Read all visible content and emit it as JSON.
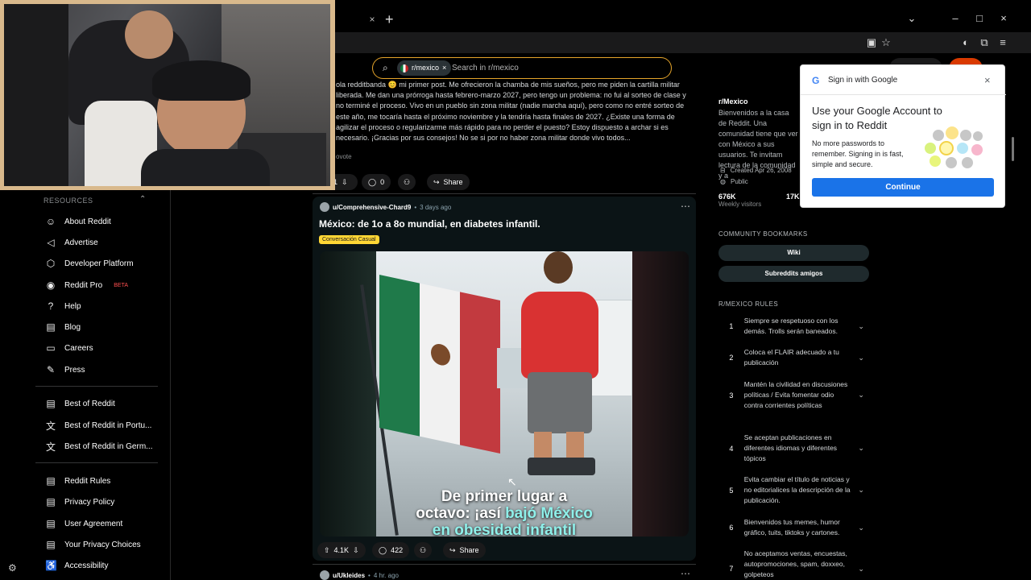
{
  "browser": {
    "new_tab": "+",
    "tab_close": "×",
    "minimize": "–",
    "maximize": "□",
    "close": "×",
    "chevron": "⌄"
  },
  "search": {
    "subreddit_chip": "r/mexico",
    "chip_close": "×",
    "placeholder": "Search in r/mexico"
  },
  "feed": {
    "prev_post_text": "ola redditbanda 😊 mi primer post. Me ofrecieron la chamba de mis sueños, pero me piden la cartilla militar liberada. Me dan una prórroga hasta febrero-marzo 2027, pero tengo un problema: no fui al sorteo de clase y no terminé el proceso. Vivo en un pueblo sin zona militar (nadie marcha aquí), pero como no entré sorteo de este año, me tocaría hasta el próximo noviembre y la tendría hasta finales de 2027. ¿Existe una forma de agilizar el proceso o regularizarme más rápido para no perder el puesto? Estoy dispuesto a archar si es necesario. ¡Gracias por sus consejos! No se si por no haber zona militar donde vivo todos...",
    "prev_upvote_label": "ovote",
    "prev_actions": {
      "score": "1",
      "comments": "0",
      "share": "Share"
    },
    "post": {
      "author": "u/Comprehensive-Chard9",
      "time": "3 days ago",
      "title": "México: de 1o a 8o mundial, en diabetes infantil.",
      "flair": "Conversación Casual",
      "caption_line1": "De primer lugar a",
      "caption_line2a": "octavo: ¡así ",
      "caption_line2b": "bajó México",
      "caption_line3": "en obesidad infantil",
      "score": "4.1K",
      "comments": "422",
      "share": "Share"
    },
    "next_post": {
      "author": "u/Ukleides",
      "time": "4 hr. ago"
    }
  },
  "sidebar": {
    "resources_header": "RESOURCES",
    "items": [
      {
        "label": "About Reddit",
        "icon": "reddit-icon"
      },
      {
        "label": "Advertise",
        "icon": "megaphone-icon"
      },
      {
        "label": "Developer Platform",
        "icon": "hexagon-icon"
      },
      {
        "label": "Reddit Pro",
        "icon": "pro-icon",
        "badge": "BETA"
      },
      {
        "label": "Help",
        "icon": "help-icon"
      },
      {
        "label": "Blog",
        "icon": "book-icon"
      },
      {
        "label": "Careers",
        "icon": "briefcase-icon"
      },
      {
        "label": "Press",
        "icon": "pen-icon"
      },
      {
        "label": "Best of Reddit",
        "icon": "book-icon"
      },
      {
        "label": "Best of Reddit in Portu...",
        "icon": "translate-icon"
      },
      {
        "label": "Best of Reddit in Germ...",
        "icon": "translate-icon"
      },
      {
        "label": "Reddit Rules",
        "icon": "book-icon"
      },
      {
        "label": "Privacy Policy",
        "icon": "book-icon"
      },
      {
        "label": "User Agreement",
        "icon": "book-icon"
      },
      {
        "label": "Your Privacy Choices",
        "icon": "book-icon"
      },
      {
        "label": "Accessibility",
        "icon": "accessibility-icon"
      }
    ]
  },
  "community": {
    "name": "r/Mexico",
    "description": "Bienvenidos a la casa de Reddit. Una comunidad tiene que ver con México a sus usuarios. Te invitam lectura de la comunidad y a",
    "created": "Created Apr 26, 2008",
    "visibility": "Public",
    "visitors_num": "676K",
    "visitors_label": "Weekly visitors",
    "contrib_num": "17K",
    "contrib_label": "Weekly contributions",
    "bookmarks_header": "COMMUNITY BOOKMARKS",
    "bookmarks": [
      "Wiki",
      "Subreddits amigos"
    ],
    "rules_header": "R/MEXICO RULES",
    "rules": [
      {
        "num": "1",
        "text": "Siempre se respetuoso con los demás. Trolls serán baneados."
      },
      {
        "num": "2",
        "text": "Coloca el FLAIR adecuado a tu publicación"
      },
      {
        "num": "3",
        "text": "Mantén la civilidad en discusiones políticas / Evita fomentar odio contra corrientes políticas"
      },
      {
        "num": "4",
        "text": "Se aceptan publicaciones en diferentes idiomas y diferentes tópicos"
      },
      {
        "num": "5",
        "text": "Evita cambiar el título de noticias y no editorialices la descripción de la publicación."
      },
      {
        "num": "6",
        "text": "Bienvenidos tus memes, humor gráfico, tuits, tiktoks y cartones."
      },
      {
        "num": "7",
        "text": "No aceptamos ventas, encuestas, autopromociones, spam, doxxeo, golpeteos"
      }
    ]
  },
  "google_popup": {
    "header": "Sign in with Google",
    "title": "Use your Google Account to sign in to Reddit",
    "body": "No more passwords to remember. Signing in is fast, simple and secure.",
    "button": "Continue",
    "close": "×"
  },
  "colors": {
    "accent_orange": "#e5a42a",
    "google_blue": "#1a73e8",
    "flair_yellow": "#ffd635",
    "background": "#000000"
  }
}
